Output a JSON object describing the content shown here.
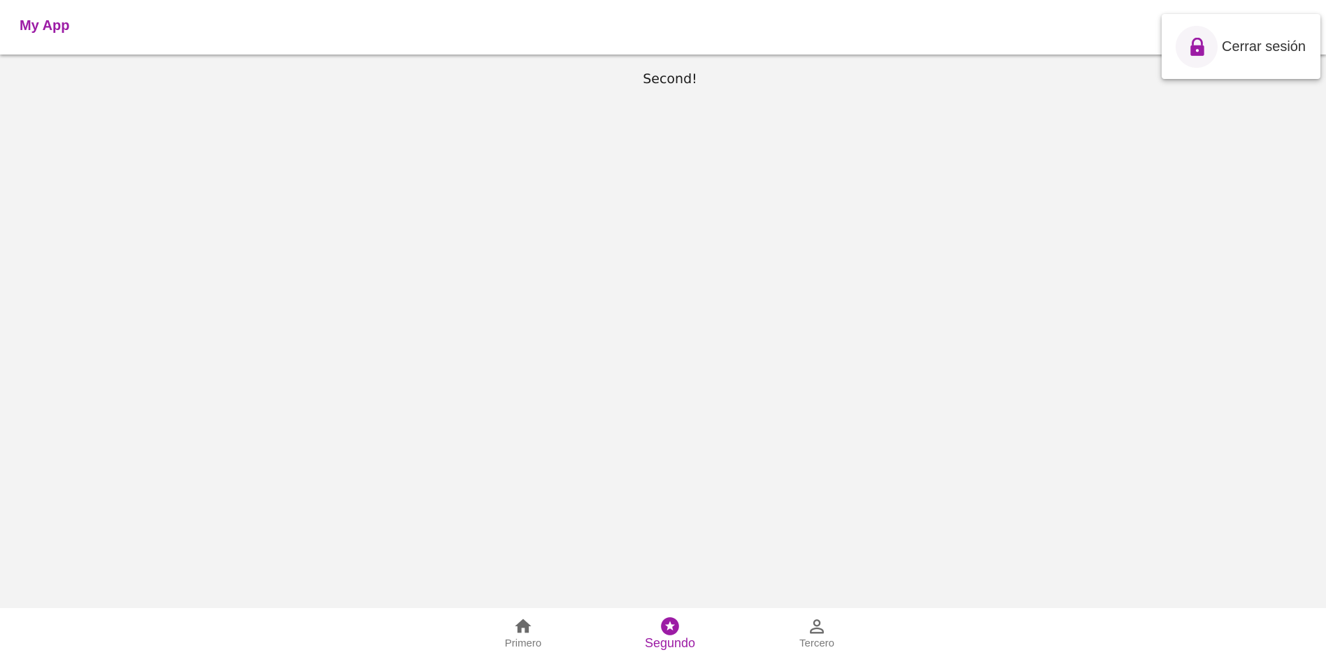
{
  "app": {
    "title": "My App",
    "accent_color": "#9c1ca5"
  },
  "main": {
    "text": "Second!"
  },
  "popup_menu": {
    "items": [
      {
        "label": "Cerrar sesión",
        "icon": "lock-icon"
      }
    ]
  },
  "bottom_nav": {
    "selected": "Segundo",
    "items": [
      {
        "label": "Primero",
        "icon": "home-icon"
      },
      {
        "label": "Segundo",
        "icon": "star-circle-icon"
      },
      {
        "label": "Tercero",
        "icon": "person-icon"
      }
    ]
  }
}
